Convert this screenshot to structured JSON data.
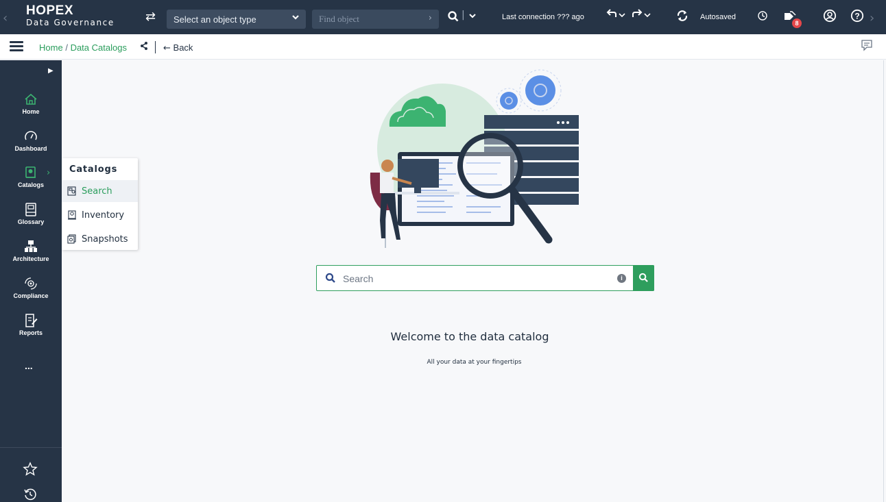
{
  "header": {
    "logo_title": "HOPEX",
    "logo_subtitle": "Data Governance",
    "object_type_placeholder": "Select an object type",
    "find_object_placeholder": "Find object",
    "last_connection": "Last connection ??? ago",
    "autosaved": "Autosaved",
    "notification_count": "8"
  },
  "breadcrumb": {
    "home": "Home",
    "separator": "/",
    "current": "Data Catalogs",
    "back": "Back"
  },
  "sidebar": {
    "items": [
      {
        "label": "Home",
        "icon": "home-icon"
      },
      {
        "label": "Dashboard",
        "icon": "gauge-icon"
      },
      {
        "label": "Catalogs",
        "icon": "catalog-icon"
      },
      {
        "label": "Glossary",
        "icon": "glossary-icon"
      },
      {
        "label": "Architecture",
        "icon": "architecture-icon"
      },
      {
        "label": "Compliance",
        "icon": "compliance-icon"
      },
      {
        "label": "Reports",
        "icon": "reports-icon"
      }
    ],
    "more": "..."
  },
  "flyout": {
    "title": "Catalogs",
    "items": [
      {
        "label": "Search"
      },
      {
        "label": "Inventory"
      },
      {
        "label": "Snapshots"
      }
    ]
  },
  "main": {
    "search_placeholder": "Search",
    "welcome": "Welcome to the data catalog",
    "tagline": "All your data at your fingertips"
  },
  "colors": {
    "navy": "#263446",
    "accent_green": "#2e9e5d",
    "badge_red": "#e5474a"
  }
}
